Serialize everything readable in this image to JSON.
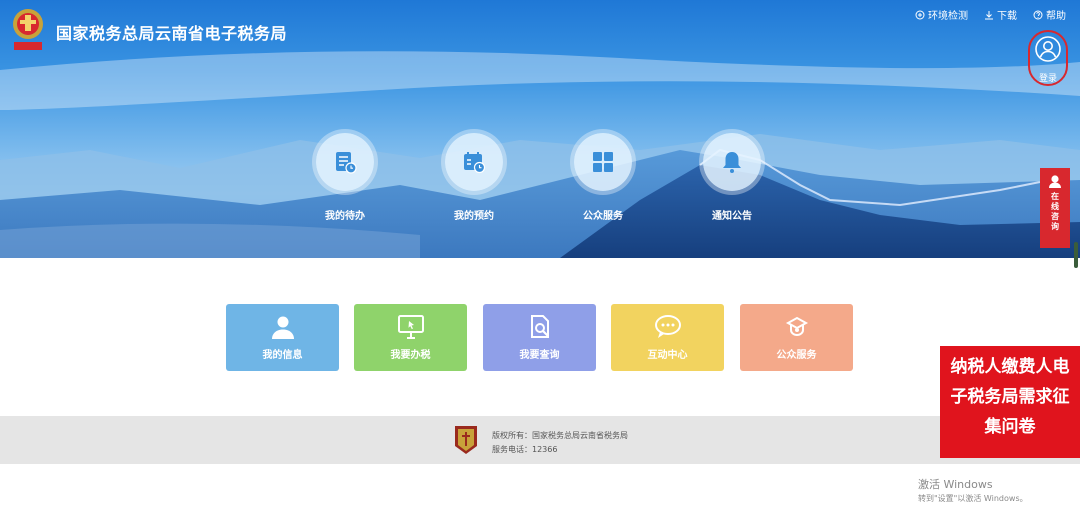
{
  "header": {
    "site_title": "国家税务总局云南省电子税务局",
    "links": [
      {
        "icon": "wrench-icon",
        "label": "环境检测"
      },
      {
        "icon": "download-icon",
        "label": "下载"
      },
      {
        "icon": "question-icon",
        "label": "帮助"
      }
    ],
    "login_label": "登录"
  },
  "quick_nav": [
    {
      "icon": "todo-icon",
      "label": "我的待办"
    },
    {
      "icon": "calendar-icon",
      "label": "我的预约"
    },
    {
      "icon": "grid-icon",
      "label": "公众服务"
    },
    {
      "icon": "bell-icon",
      "label": "通知公告"
    }
  ],
  "side_consult": {
    "label": "在线咨询"
  },
  "tiles": [
    {
      "icon": "user-icon",
      "label": "我的信息",
      "color": "#6fb5e6"
    },
    {
      "icon": "monitor-icon",
      "label": "我要办税",
      "color": "#8fd36b"
    },
    {
      "icon": "search-doc-icon",
      "label": "我要查询",
      "color": "#8f9fe8"
    },
    {
      "icon": "chat-icon",
      "label": "互动中心",
      "color": "#f2d35f"
    },
    {
      "icon": "service-icon",
      "label": "公众服务",
      "color": "#f4a98a"
    }
  ],
  "footer": {
    "copyright": "版权所有：国家税务总局云南省税务局",
    "phone": "服务电话：12366"
  },
  "survey": {
    "label": "纳税人缴费人电子税务局需求征集问卷"
  },
  "windows_watermark": {
    "line1": "激活 Windows",
    "line2": "转到\"设置\"以激活 Windows。"
  },
  "colors": {
    "accent_red": "#d8282e",
    "banner_blue": "#1f78d6"
  }
}
